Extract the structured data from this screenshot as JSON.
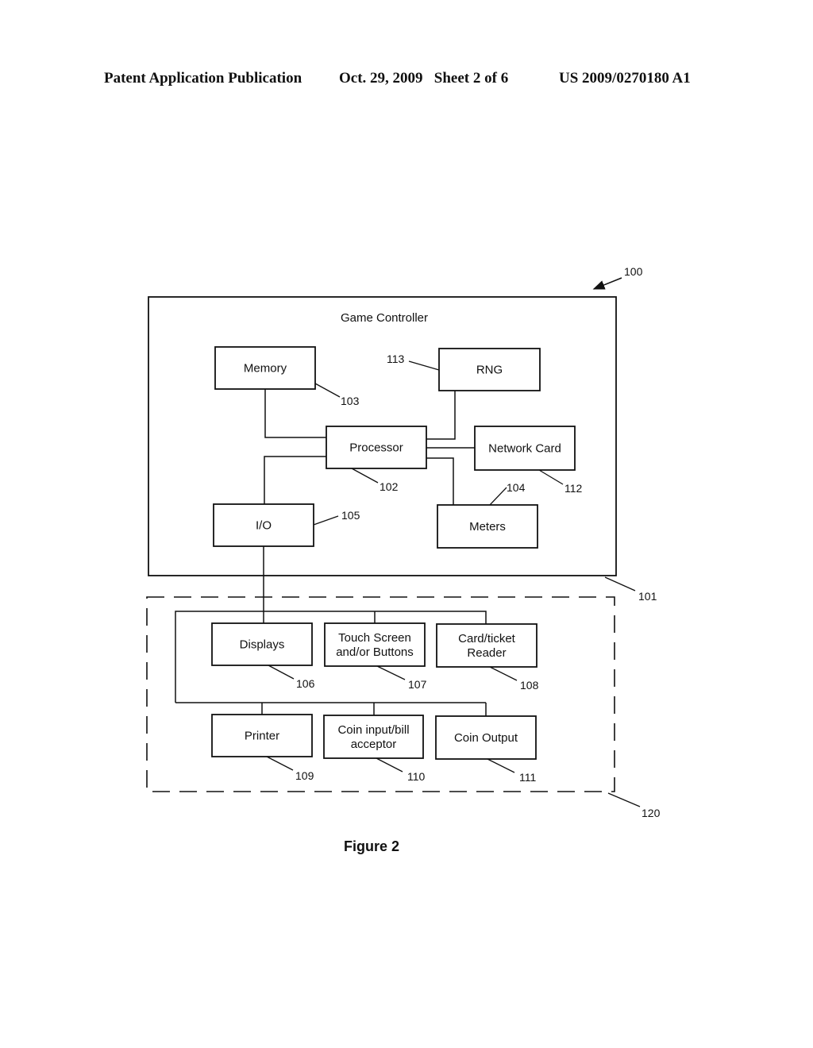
{
  "header": {
    "publication": "Patent Application Publication",
    "date_sheet": "Oct. 29, 2009   Sheet 2 of 6",
    "patent_number": "US 2009/0270180 A1"
  },
  "diagram": {
    "system_ref": "100",
    "controller": {
      "title": "Game Controller",
      "ref": "101"
    },
    "peripherals_group_ref": "120",
    "blocks": {
      "memory": {
        "label": [
          "Memory"
        ],
        "ref": "103"
      },
      "rng": {
        "label": [
          "RNG"
        ],
        "ref": "113"
      },
      "processor": {
        "label": [
          "Processor"
        ],
        "ref": "102"
      },
      "network_card": {
        "label": [
          "Network Card"
        ],
        "ref": "112"
      },
      "io": {
        "label": [
          "I/O"
        ],
        "ref": "105"
      },
      "meters": {
        "label": [
          "Meters"
        ],
        "ref": "104"
      },
      "displays": {
        "label": [
          "Displays"
        ],
        "ref": "106"
      },
      "touch_screen": {
        "label": [
          "Touch Screen",
          "and/or Buttons"
        ],
        "ref": "107"
      },
      "card_reader": {
        "label": [
          "Card/ticket",
          "Reader"
        ],
        "ref": "108"
      },
      "printer": {
        "label": [
          "Printer"
        ],
        "ref": "109"
      },
      "coin_input": {
        "label": [
          "Coin input/bill",
          "acceptor"
        ],
        "ref": "110"
      },
      "coin_output": {
        "label": [
          "Coin Output"
        ],
        "ref": "111"
      }
    },
    "caption": "Figure 2"
  }
}
